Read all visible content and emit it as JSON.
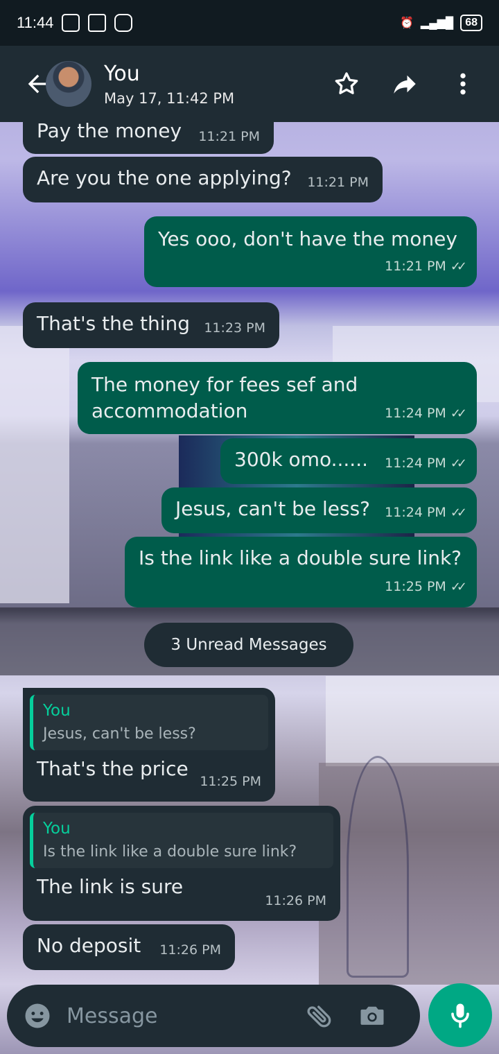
{
  "status_bar": {
    "time": "11:44",
    "battery": "68",
    "icons": [
      "image-icon",
      "message-icon",
      "instagram-icon",
      "alarm-icon",
      "signal-icon"
    ]
  },
  "header": {
    "contact_name": "You",
    "subtitle": "May 17, 11:42 PM",
    "icons": [
      "back-arrow-icon",
      "star-icon",
      "forward-icon",
      "more-vert-icon"
    ]
  },
  "messages": [
    {
      "direction": "in",
      "text": "Pay the money",
      "time": "11:21 PM"
    },
    {
      "direction": "in",
      "text": "Are you the one applying?",
      "time": "11:21 PM"
    },
    {
      "direction": "out",
      "text": "Yes ooo, don't have the money",
      "time": "11:21 PM"
    },
    {
      "direction": "in",
      "text": "That's the thing",
      "time": "11:23 PM"
    },
    {
      "direction": "out",
      "text": "The money for fees sef and accommodation",
      "time": "11:24 PM"
    },
    {
      "direction": "out",
      "text": "300k omo......",
      "time": "11:24 PM"
    },
    {
      "direction": "out",
      "text": "Jesus, can't be less?",
      "time": "11:24 PM"
    },
    {
      "direction": "out",
      "text": "Is the link like a double sure link?",
      "time": "11:25 PM"
    },
    {
      "direction": "in",
      "quote_author": "You",
      "quote_text": "Jesus, can't be less?",
      "text": "That's the price",
      "time": "11:25 PM"
    },
    {
      "direction": "in",
      "quote_author": "You",
      "quote_text": "Is the link like a double sure link?",
      "text": "The link is sure",
      "time": "11:26 PM"
    },
    {
      "direction": "in",
      "text": "No deposit",
      "time": "11:26 PM"
    }
  ],
  "unread_label": "3 Unread Messages",
  "composer": {
    "placeholder": "Message",
    "icons": [
      "emoji-icon",
      "paperclip-icon",
      "camera-icon",
      "mic-icon"
    ]
  },
  "colors": {
    "incoming_bubble": "#1f2c34",
    "outgoing_bubble": "#005c4b",
    "accent": "#00a884",
    "quote_author": "#06cf9c"
  }
}
